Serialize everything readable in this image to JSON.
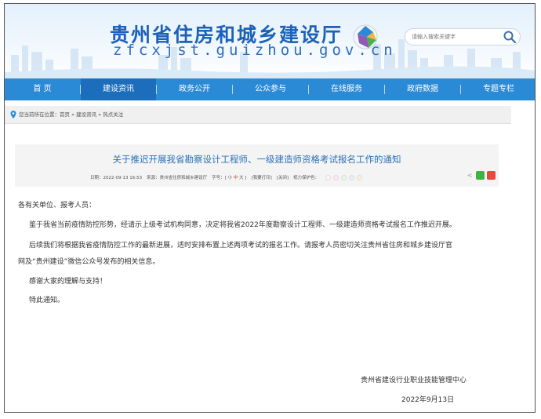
{
  "header": {
    "site_title": "贵州省住房和城乡建设厅",
    "site_domain": "zfcxjst.guizhou.gov.cn",
    "search_placeholder": "请输入搜索关键字"
  },
  "nav": {
    "items": [
      {
        "label": "首 页"
      },
      {
        "label": "建设资讯"
      },
      {
        "label": "政务公开"
      },
      {
        "label": "公众参与"
      },
      {
        "label": "在线服务"
      },
      {
        "label": "政府数据"
      },
      {
        "label": "专题专栏"
      }
    ],
    "active_index": 1
  },
  "breadcrumb": {
    "prefix": "您当前所在位置：",
    "items": [
      "首页",
      "建设资讯",
      "热点关注"
    ],
    "separator": " » "
  },
  "article": {
    "title": "关于推迟开展我省勘察设计工程师、一级建造师资格考试报名工作的通知",
    "meta": {
      "date": "日期：2022-09-13 16:53",
      "source": "来源：贵州省住房和城乡建设厅",
      "font_label": "字号：[",
      "font_small": "小",
      "font_medium": "中",
      "font_large": "大",
      "font_close": "]",
      "print_label": "[我要打印]",
      "close_label": "[关闭]",
      "eyecare_label": "视力保护色："
    },
    "eyecare_colors": [
      "#f8f8f8",
      "#fde9e9",
      "#e9f6e9",
      "#e6eefc",
      "#f6f0e0"
    ],
    "greeting": "各有关单位、报考人员：",
    "paragraphs": [
      "鉴于我省当前疫情防控形势，经请示上级考试机构同意，决定将我省2022年度勘察设计工程师、一级建造师资格考试报名工作推迟开展。",
      "后续我们将根据我省疫情防控工作的最新进展，适时安排布置上述两项考试的报名工作。请报考人员密切关注贵州省住房和城乡建设厅官",
      "网及“贵州建设”微信公众号发布的相关信息。",
      "感谢大家的理解与支持！",
      "特此通知。"
    ],
    "signature_org": "贵州省建设行业职业技能管理中心",
    "signature_date": "2022年9月13日"
  }
}
